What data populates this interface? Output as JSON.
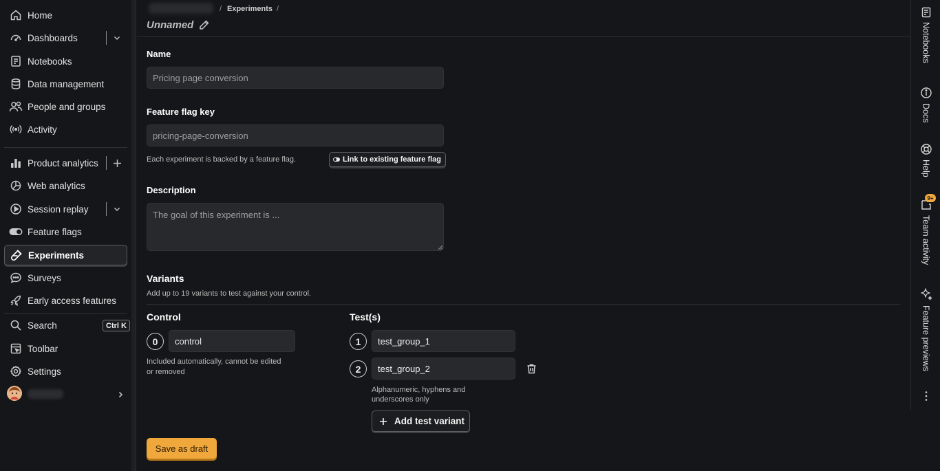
{
  "sidebar": {
    "items": [
      {
        "label": "Home",
        "icon": "home-icon"
      },
      {
        "label": "Dashboards",
        "icon": "dashboard-icon"
      },
      {
        "label": "Notebooks",
        "icon": "notebook-icon"
      },
      {
        "label": "Data management",
        "icon": "database-icon"
      },
      {
        "label": "People and groups",
        "icon": "people-icon"
      },
      {
        "label": "Activity",
        "icon": "activity-icon"
      },
      {
        "label": "Product analytics",
        "icon": "bar-chart-icon"
      },
      {
        "label": "Web analytics",
        "icon": "pie-chart-icon"
      },
      {
        "label": "Session replay",
        "icon": "play-icon"
      },
      {
        "label": "Feature flags",
        "icon": "toggle-icon"
      },
      {
        "label": "Experiments",
        "icon": "flask-icon"
      },
      {
        "label": "Surveys",
        "icon": "chat-icon"
      },
      {
        "label": "Early access features",
        "icon": "rocket-icon"
      },
      {
        "label": "Search",
        "icon": "search-icon"
      },
      {
        "label": "Toolbar",
        "icon": "toolbar-icon"
      },
      {
        "label": "Settings",
        "icon": "gear-icon"
      }
    ],
    "search_shortcut": "Ctrl K",
    "active": "Experiments"
  },
  "header": {
    "breadcrumb_current": "Experiments",
    "title": "Unnamed"
  },
  "form": {
    "name": {
      "label": "Name",
      "placeholder": "Pricing page conversion"
    },
    "flag_key": {
      "label": "Feature flag key",
      "placeholder": "pricing-page-conversion",
      "help": "Each experiment is backed by a feature flag.",
      "link_button": "Link to existing feature flag"
    },
    "description": {
      "label": "Description",
      "placeholder": "The goal of this experiment is ..."
    },
    "variants": {
      "title": "Variants",
      "subtitle": "Add up to 19 variants to test against your control.",
      "control_title": "Control",
      "control": {
        "index": "0",
        "value": "control"
      },
      "control_help_1": "Included automatically, cannot be edited",
      "control_help_2": "or removed",
      "tests_title": "Test(s)",
      "tests": [
        {
          "index": "1",
          "value": "test_group_1"
        },
        {
          "index": "2",
          "value": "test_group_2"
        }
      ],
      "tests_help_1": "Alphanumeric, hyphens and",
      "tests_help_2": "underscores only",
      "add_button": "Add test variant"
    },
    "save_button": "Save as draft"
  },
  "right_bar": {
    "items": [
      {
        "label": "Notebooks",
        "icon": "notebook-icon"
      },
      {
        "label": "Docs",
        "icon": "info-icon"
      },
      {
        "label": "Help",
        "icon": "lifebuoy-icon"
      },
      {
        "label": "Team activity",
        "icon": "bell-icon"
      },
      {
        "label": "Feature previews",
        "icon": "sparkle-icon"
      }
    ],
    "badge": "9+"
  },
  "colors": {
    "background": "#151619",
    "input_bg": "#28292d",
    "primary": "#f0a73c"
  }
}
